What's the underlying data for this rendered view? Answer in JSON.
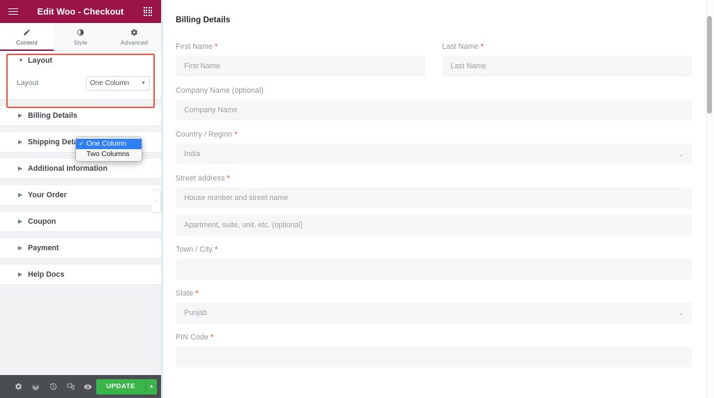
{
  "panel": {
    "header": {
      "title": "Edit Woo - Checkout",
      "menu_icon": "hamburger-icon",
      "apps_icon": "grid-apps-icon"
    },
    "tabs": [
      {
        "label": "Content",
        "icon": "pencil-icon",
        "active": true
      },
      {
        "label": "Style",
        "icon": "half-circle-icon",
        "active": false
      },
      {
        "label": "Advanced",
        "icon": "gear-icon",
        "active": false
      }
    ],
    "sections": [
      {
        "label": "Layout",
        "expanded": true
      },
      {
        "label": "Billing Details",
        "expanded": false
      },
      {
        "label": "Shipping Details",
        "expanded": false
      },
      {
        "label": "Additional Information",
        "expanded": false
      },
      {
        "label": "Your Order",
        "expanded": false
      },
      {
        "label": "Coupon",
        "expanded": false
      },
      {
        "label": "Payment",
        "expanded": false
      },
      {
        "label": "Help Docs",
        "expanded": false
      }
    ],
    "layout_control": {
      "label": "Layout",
      "value": "One Column",
      "options": [
        {
          "label": "One Column",
          "selected": true
        },
        {
          "label": "Two Columns",
          "selected": false
        }
      ],
      "check_glyph": "✓"
    },
    "footer": {
      "icons": [
        "settings-gear-icon",
        "navigator-layers-icon",
        "history-revisions-icon",
        "responsive-mode-icon",
        "preview-eye-icon"
      ],
      "update_label": "UPDATE",
      "update_caret": "▲"
    },
    "collapse_handle": "‹",
    "highlight_color": "#FF4F3C",
    "brand_color": "#9B1447",
    "update_color": "#39B54A",
    "dropdown_highlight_color": "#2F7FF7"
  },
  "canvas": {
    "form_title": "Billing Details",
    "required_marker": "*",
    "fields": [
      {
        "name": "first-name",
        "label": "First Name",
        "required": true,
        "type": "text",
        "placeholder": "First Name",
        "value": "",
        "column": "left"
      },
      {
        "name": "last-name",
        "label": "Last Name",
        "required": true,
        "type": "text",
        "placeholder": "Last Name",
        "value": "",
        "column": "right"
      },
      {
        "name": "company-name",
        "label": "Company Name (optional)",
        "required": false,
        "type": "text",
        "placeholder": "Company Name",
        "value": "",
        "column": "full"
      },
      {
        "name": "country-region",
        "label": "Country / Region",
        "required": true,
        "type": "select",
        "placeholder": "",
        "value": "India",
        "column": "full"
      },
      {
        "name": "street-address",
        "label": "Street address",
        "required": true,
        "type": "text",
        "placeholder": "House number and street name",
        "value": "",
        "column": "full"
      },
      {
        "name": "apartment",
        "label": "",
        "required": false,
        "type": "text",
        "placeholder": "Apartment, suite, unit, etc. (optional)",
        "value": "",
        "column": "full"
      },
      {
        "name": "town-city",
        "label": "Town / City",
        "required": true,
        "type": "text",
        "placeholder": "",
        "value": "",
        "column": "full"
      },
      {
        "name": "state",
        "label": "State",
        "required": true,
        "type": "select",
        "placeholder": "",
        "value": "Punjab",
        "column": "full"
      },
      {
        "name": "pin-code",
        "label": "PIN Code",
        "required": true,
        "type": "text",
        "placeholder": "",
        "value": "",
        "column": "full"
      }
    ],
    "select_caret": "⌄"
  }
}
